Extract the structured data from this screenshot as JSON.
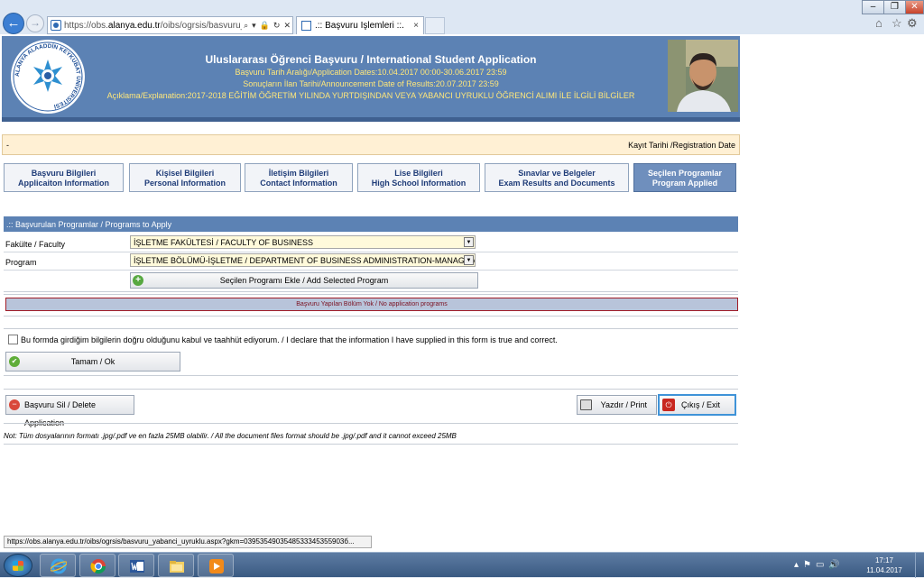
{
  "browser": {
    "url_prefix": "https://obs.",
    "url_domain": "alanya.edu.tr",
    "url_rest": "/oibs/ogrsis/basvuru_yaban",
    "tab_title": ".:: Başvuru İşlemleri ::.",
    "tab_close": "×"
  },
  "header": {
    "logo_text": "ALANYA ALAADDİN KEYKUBAT ÜNİVERSİTESİ",
    "title": "Uluslararası Öğrenci Başvuru / International Student Application",
    "dates": "Başvuru Tarih Aralığı/Application Dates:10.04.2017 00:00-30.06.2017 23:59",
    "results": "Sonuçların İlan Tarihi/Announcement Date of Results:20.07.2017 23:59",
    "explanation": "Açıklama/Explanation:2017-2018 EĞİTİM ÖĞRETİM YILINDA YURTDIŞINDAN VEYA YABANCI UYRUKLU ÖĞRENCİ ALIMI İLE İLGİLİ BİLGİLER"
  },
  "registration": {
    "left": "-",
    "right": "Kayıt Tarihi /Registration Date"
  },
  "tabs": [
    {
      "line1": "Başvuru Bilgileri",
      "line2": "Applicaiton Information"
    },
    {
      "line1": "Kişisel Bilgileri",
      "line2": "Personal Information"
    },
    {
      "line1": "İletişim Bilgileri",
      "line2": "Contact Information"
    },
    {
      "line1": "Lise Bilgileri",
      "line2": "High School Information"
    },
    {
      "line1": "Sınavlar ve Belgeler",
      "line2": "Exam Results and Documents"
    },
    {
      "line1": "Seçilen Programlar",
      "line2": "Program Applied"
    }
  ],
  "programs": {
    "section_title": ".:: Başvurulan Programlar / Programs to Apply",
    "faculty_label": "Fakülte / Faculty",
    "faculty_value": "İŞLETME FAKÜLTESİ / FACULTY OF BUSINESS",
    "program_label": "Program",
    "program_value": "İŞLETME BÖLÜMÜ-İŞLETME / DEPARTMENT OF BUSINESS ADMINISTRATION-MANAGEMENT",
    "add_button": "Seçilen Programı Ekle / Add Selected Program",
    "empty_message": "Başvuru Yapılan Bölüm Yok / No application programs"
  },
  "consent": {
    "text": "Bu formda girdiğim bilgilerin doğru olduğunu kabul ve taahhüt ediyorum. / I declare that the information I have supplied in this form is true and correct.",
    "checked": false
  },
  "buttons": {
    "ok": "Tamam / Ok",
    "delete": "Başvuru Sil / Delete Application",
    "print": "Yazdır / Print",
    "exit": "Çıkış / Exit"
  },
  "note": "Not: Tüm dosyalarının formatı .jpg/.pdf ve en fazla 25MB olabilir. / All the document files format should be .jpg/.pdf and it cannot exceed 25MB",
  "status_url": "https://obs.alanya.edu.tr/oibs/ogrsis/basvuru_yabanci_uyruklu.aspx?gkm=0395354903548533345355903б...",
  "taskbar": {
    "time": "17:17",
    "date": "11.04.2017"
  },
  "colors": {
    "header_blue": "#5c82b4",
    "header_accent_text": "#ffe77a",
    "active_tab": "#6f8fbd",
    "error_border": "#a11c28"
  }
}
